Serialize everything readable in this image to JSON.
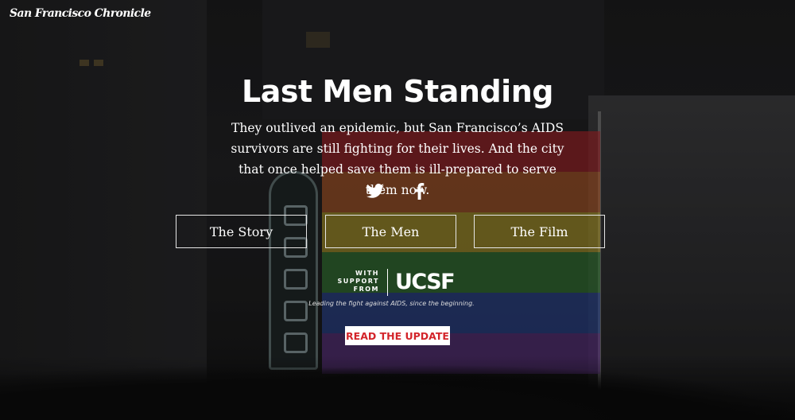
{
  "header": {
    "logo_text": "San Francisco Chronicle"
  },
  "hero": {
    "title": "Last Men Standing",
    "dek": "They outlived an epidemic, but San Francisco’s AIDS survivors are still fighting for their lives. And the city that once helped save them is ill-prepared to serve them now."
  },
  "social": {
    "icons": [
      "twitter-icon",
      "facebook-icon"
    ]
  },
  "nav": {
    "story_label": "The Story",
    "men_label": "The Men",
    "film_label": "The Film"
  },
  "sponsor": {
    "with_support_text": "WITH\nSUPPORT\nFROM",
    "logo_text": "UCSF",
    "tagline": "Leading the fight against AIDS, since the beginning."
  },
  "cta": {
    "update_label": "READ THE UPDATE"
  },
  "colors": {
    "accent_red": "#d3242a",
    "text": "#ffffff",
    "background": "#141414"
  }
}
